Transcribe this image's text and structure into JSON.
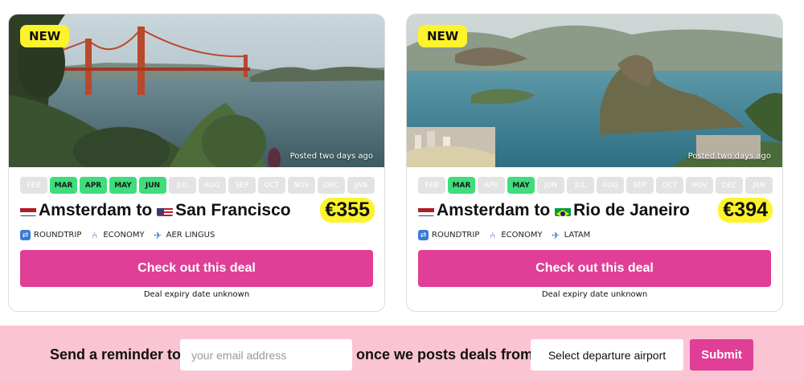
{
  "deals": [
    {
      "badge": "NEW",
      "posted": "Posted two days ago",
      "months": [
        {
          "label": "FEB",
          "active": false
        },
        {
          "label": "MAR",
          "active": true
        },
        {
          "label": "APR",
          "active": true
        },
        {
          "label": "MAY",
          "active": true
        },
        {
          "label": "JUN",
          "active": true
        },
        {
          "label": "JUL",
          "active": false
        },
        {
          "label": "AUG",
          "active": false
        },
        {
          "label": "SEP",
          "active": false
        },
        {
          "label": "OCT",
          "active": false
        },
        {
          "label": "NOV",
          "active": false
        },
        {
          "label": "DEC",
          "active": false
        },
        {
          "label": "JAN",
          "active": false
        }
      ],
      "from": "Amsterdam",
      "connector": "to",
      "to": "San Francisco",
      "price": "€355",
      "trip_type": "ROUNDTRIP",
      "cabin": "ECONOMY",
      "airline": "AER LINGUS",
      "cta": "Check out this deal",
      "expiry": "Deal expiry date unknown"
    },
    {
      "badge": "NEW",
      "posted": "Posted two days ago",
      "months": [
        {
          "label": "FEB",
          "active": false
        },
        {
          "label": "MAR",
          "active": true
        },
        {
          "label": "APR",
          "active": false
        },
        {
          "label": "MAY",
          "active": true
        },
        {
          "label": "JUN",
          "active": false
        },
        {
          "label": "JUL",
          "active": false
        },
        {
          "label": "AUG",
          "active": false
        },
        {
          "label": "SEP",
          "active": false
        },
        {
          "label": "OCT",
          "active": false
        },
        {
          "label": "NOV",
          "active": false
        },
        {
          "label": "DEC",
          "active": false
        },
        {
          "label": "JAN",
          "active": false
        }
      ],
      "from": "Amsterdam",
      "connector": "to",
      "to": "Rio de Janeiro",
      "price": "€394",
      "trip_type": "ROUNDTRIP",
      "cabin": "ECONOMY",
      "airline": "LATAM",
      "cta": "Check out this deal",
      "expiry": "Deal expiry date unknown"
    }
  ],
  "reminder": {
    "lead": "Send a reminder to",
    "email_placeholder": "your email address",
    "middle": "once we posts deals from",
    "airport_label": "Select departure airport",
    "submit": "Submit"
  },
  "colors": {
    "accent": "#e03e97",
    "badge": "#fdf32c",
    "month_active": "#3fdd7c",
    "footer_bg": "#fbc4d3"
  }
}
